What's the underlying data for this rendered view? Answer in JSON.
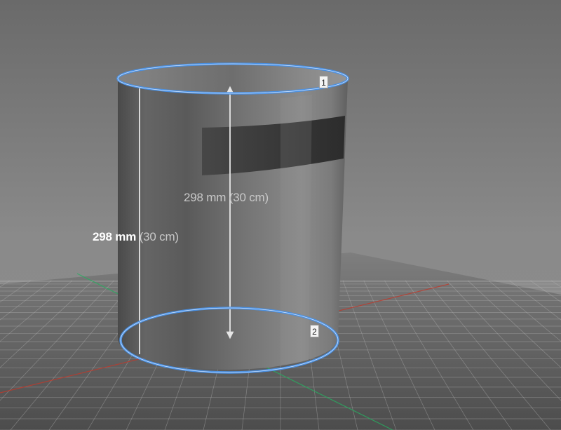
{
  "colors": {
    "background_top": "#6c6c6c",
    "background_bottom": "#8a8a8a",
    "selection": "#4a90e2",
    "label_primary": "#ffffff",
    "label_secondary": "#c8c8c8",
    "grid": "#b8b8b8",
    "axis_x": "#c0392b",
    "axis_y": "#27ae60"
  },
  "dimensions": {
    "inner_label": {
      "primary": "298 mm",
      "secondary": "(30 cm)"
    },
    "outer_label": {
      "primary": "298 mm",
      "secondary": "(30 cm)"
    }
  },
  "markers": {
    "top": "1",
    "bottom": "2"
  },
  "icons": {
    "dimension_arrow": "double-arrow-icon"
  }
}
